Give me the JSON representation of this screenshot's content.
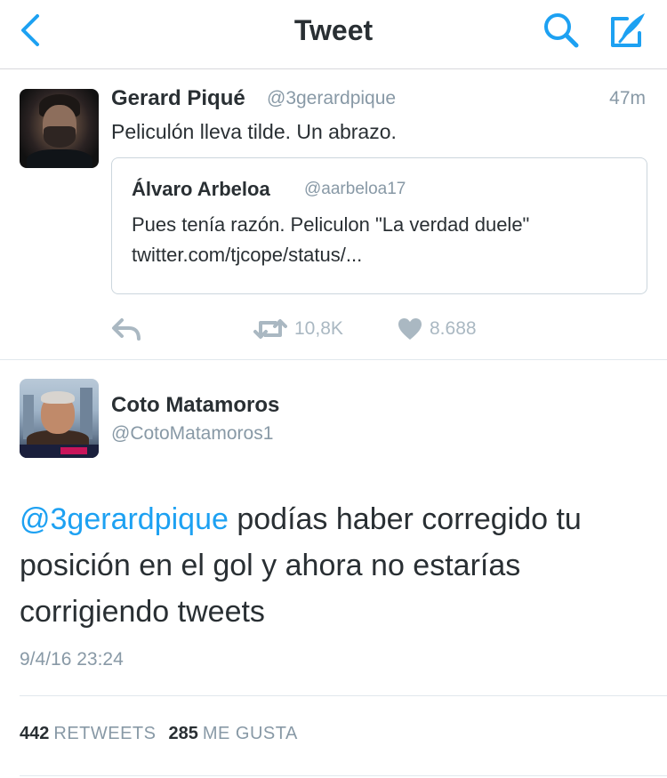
{
  "colors": {
    "accent": "#1da1f2",
    "muted": "#8899a6",
    "text": "#292f33",
    "action_icon": "#aab8c2"
  },
  "navbar": {
    "title": "Tweet",
    "back_icon": "chevron-left-icon",
    "search_icon": "search-icon",
    "compose_icon": "compose-icon"
  },
  "tweet": {
    "name": "Gerard Piqué",
    "handle": "@3gerardpique",
    "time": "47m",
    "text": "Peliculón lleva tilde. Un abrazo.",
    "quoted": {
      "name": "Álvaro Arbeloa",
      "handle": "@aarbeloa17",
      "text_line1": "Pues tenía razón. Peliculon \"La verdad duele\"",
      "text_line2": "twitter.com/tjcope/status/..."
    },
    "actions": {
      "reply_icon": "reply-icon",
      "retweet_icon": "retweet-icon",
      "retweet_count": "10,8K",
      "like_icon": "heart-icon",
      "like_count": "8.688"
    }
  },
  "reply": {
    "name": "Coto Matamoros",
    "handle": "@CotoMatamoros1",
    "mention": "@3gerardpique",
    "text": " podías haber corregido tu posición en el gol y ahora no estarías corrigiendo tweets",
    "date": "9/4/16 23:24",
    "retweets_count": "442",
    "retweets_label": "RETWEETS",
    "likes_count": "285",
    "likes_label": "ME GUSTA"
  }
}
